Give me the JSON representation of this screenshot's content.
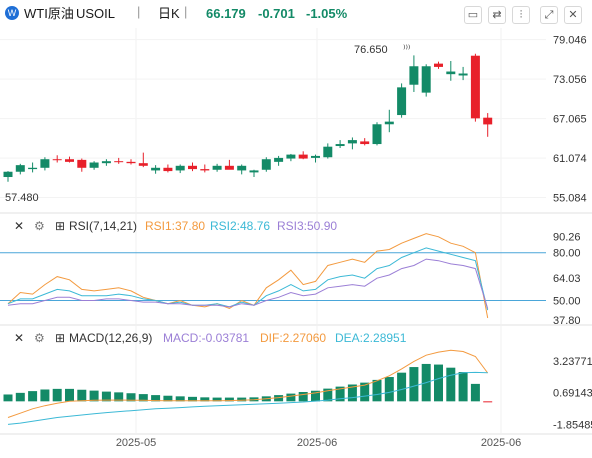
{
  "toolbar": {
    "symbol_name": "WTI原油",
    "symbol_code": "USOIL",
    "interval": "日K",
    "price": "66.179",
    "change": "-0.701",
    "change_pct": "-1.05%",
    "icons": [
      "chart-settings-icon",
      "compare-icon",
      "indicators-icon",
      "fullscreen-icon",
      "close-icon"
    ]
  },
  "main": {
    "high_label": "76.650",
    "low_label": "57.480"
  },
  "rsi": {
    "title": "RSI(7,14,21)",
    "rsi1_label": "RSI1:37.80",
    "rsi2_label": "RSI2:48.76",
    "rsi3_label": "RSI3:50.90"
  },
  "macd": {
    "title": "MACD(12,26,9)",
    "macd_label": "MACD:-0.03781",
    "dif_label": "DIF:2.27060",
    "dea_label": "DEA:2.28951"
  },
  "colors": {
    "up": "#138a67",
    "down": "#e8202a",
    "rsi1": "#f39a3f",
    "rsi2": "#3cb9d6",
    "rsi3": "#9b7fd6",
    "dif": "#f39a3f",
    "dea": "#3cb9d6",
    "ref_line": "#4aa6d9"
  },
  "chart_data": [
    {
      "type": "candlestick",
      "name": "price",
      "x_ticks": [
        "2025-05",
        "2025-06",
        "2025-06"
      ],
      "y_ticks": [
        79.046,
        73.056,
        67.065,
        61.074,
        55.084
      ],
      "ylim": [
        53.5,
        80.5
      ],
      "ohlc": [
        [
          58.2,
          59.1,
          57.48,
          59.0
        ],
        [
          59.0,
          60.2,
          58.6,
          60.0
        ],
        [
          59.4,
          60.4,
          58.9,
          59.6
        ],
        [
          59.6,
          61.2,
          59.2,
          60.9
        ],
        [
          60.9,
          61.5,
          60.4,
          60.8
        ],
        [
          60.9,
          61.3,
          60.4,
          60.5
        ],
        [
          60.8,
          61.0,
          59.0,
          59.6
        ],
        [
          59.6,
          60.6,
          59.3,
          60.4
        ],
        [
          60.3,
          60.9,
          59.9,
          60.6
        ],
        [
          60.6,
          61.1,
          60.2,
          60.5
        ],
        [
          60.5,
          60.9,
          60.1,
          60.3
        ],
        [
          60.3,
          61.9,
          59.7,
          59.9
        ],
        [
          59.2,
          60.0,
          58.7,
          59.6
        ],
        [
          59.6,
          60.1,
          58.9,
          59.1
        ],
        [
          59.2,
          60.1,
          58.8,
          59.9
        ],
        [
          59.9,
          60.4,
          59.1,
          59.4
        ],
        [
          59.4,
          60.1,
          58.9,
          59.2
        ],
        [
          59.3,
          60.2,
          59.0,
          59.9
        ],
        [
          59.9,
          60.8,
          59.5,
          59.3
        ],
        [
          59.2,
          60.1,
          58.6,
          59.9
        ],
        [
          58.9,
          59.3,
          58.2,
          59.2
        ],
        [
          59.3,
          61.2,
          59.0,
          60.9
        ],
        [
          60.5,
          61.4,
          59.9,
          61.1
        ],
        [
          61.0,
          61.7,
          60.6,
          61.6
        ],
        [
          61.6,
          62.1,
          60.9,
          61.0
        ],
        [
          61.1,
          61.6,
          60.4,
          61.4
        ],
        [
          61.2,
          63.3,
          61.0,
          62.8
        ],
        [
          62.9,
          63.8,
          62.6,
          63.2
        ],
        [
          63.3,
          64.2,
          62.4,
          63.8
        ],
        [
          63.6,
          64.1,
          63.0,
          63.2
        ],
        [
          63.2,
          66.5,
          63.0,
          66.2
        ],
        [
          66.2,
          68.4,
          65.0,
          66.6
        ],
        [
          67.6,
          72.4,
          67.2,
          71.8
        ],
        [
          72.2,
          76.65,
          71.1,
          75.0
        ],
        [
          71.0,
          75.3,
          70.4,
          75.0
        ],
        [
          75.4,
          75.7,
          74.6,
          74.9
        ],
        [
          73.8,
          75.8,
          72.8,
          74.2
        ],
        [
          73.6,
          74.9,
          72.9,
          73.9
        ],
        [
          76.6,
          76.9,
          66.6,
          67.1
        ],
        [
          67.2,
          67.9,
          64.3,
          66.179
        ]
      ]
    },
    {
      "type": "line",
      "name": "RSI",
      "y_ticks": [
        90.26,
        80.0,
        64.03,
        50.0,
        37.8
      ],
      "ylim": [
        34,
        93
      ],
      "reference_lines": [
        80,
        50
      ],
      "series": [
        {
          "name": "RSI1",
          "values": [
            48,
            55,
            54,
            60,
            65,
            63,
            57,
            56,
            57,
            58,
            56,
            52,
            50,
            48,
            50,
            47,
            46,
            48,
            45,
            50,
            47,
            58,
            63,
            69,
            60,
            62,
            72,
            74,
            76,
            74,
            81,
            82,
            86,
            89,
            92,
            90,
            86,
            84,
            80,
            39
          ]
        },
        {
          "name": "RSI2",
          "values": [
            48,
            51,
            51,
            54,
            57,
            56,
            53,
            53,
            53,
            54,
            53,
            51,
            50,
            48,
            49,
            47,
            47,
            48,
            46,
            49,
            47,
            53,
            56,
            60,
            56,
            57,
            63,
            65,
            66,
            64,
            70,
            72,
            77,
            80,
            83,
            81,
            79,
            77,
            75,
            44
          ]
        },
        {
          "name": "RSI3",
          "values": [
            47,
            48,
            48,
            50,
            52,
            52,
            50,
            50,
            51,
            51,
            50,
            49,
            49,
            48,
            48,
            47,
            47,
            47,
            46,
            48,
            47,
            50,
            52,
            55,
            53,
            54,
            58,
            59,
            60,
            59,
            64,
            66,
            70,
            72,
            76,
            75,
            73,
            72,
            70,
            45
          ]
        }
      ],
      "last_values": {
        "RSI1": 37.8,
        "RSI2": 48.76,
        "RSI3": 50.9
      }
    },
    {
      "type": "bar+line",
      "name": "MACD",
      "y_ticks": [
        3.23771,
        0.69143,
        -1.85485
      ],
      "ylim": [
        -2.3,
        4.6
      ],
      "histogram": [
        0.55,
        0.68,
        0.82,
        0.95,
        1.0,
        1.0,
        0.93,
        0.86,
        0.78,
        0.72,
        0.65,
        0.58,
        0.5,
        0.45,
        0.4,
        0.36,
        0.32,
        0.3,
        0.3,
        0.3,
        0.32,
        0.4,
        0.5,
        0.62,
        0.75,
        0.85,
        1.02,
        1.18,
        1.35,
        1.5,
        1.72,
        1.95,
        2.3,
        2.75,
        3.0,
        2.95,
        2.7,
        2.35,
        1.4,
        -0.03781
      ],
      "series": [
        {
          "name": "DIF",
          "values": [
            -1.3,
            -0.95,
            -0.6,
            -0.35,
            -0.15,
            0.0,
            0.05,
            0.08,
            0.1,
            0.1,
            0.09,
            0.08,
            0.06,
            0.05,
            0.05,
            0.04,
            0.04,
            0.05,
            0.06,
            0.08,
            0.12,
            0.2,
            0.3,
            0.42,
            0.55,
            0.68,
            0.85,
            1.0,
            1.15,
            1.3,
            1.65,
            2.05,
            2.6,
            3.2,
            3.7,
            3.95,
            4.1,
            4.0,
            3.6,
            2.2706
          ]
        },
        {
          "name": "DEA",
          "values": [
            -1.85,
            -1.75,
            -1.6,
            -1.45,
            -1.3,
            -1.2,
            -1.1,
            -1.0,
            -0.9,
            -0.82,
            -0.75,
            -0.68,
            -0.6,
            -0.55,
            -0.5,
            -0.45,
            -0.4,
            -0.36,
            -0.32,
            -0.28,
            -0.24,
            -0.2,
            -0.15,
            -0.1,
            -0.05,
            0.02,
            0.1,
            0.2,
            0.3,
            0.42,
            0.55,
            0.72,
            0.95,
            1.22,
            1.5,
            1.82,
            2.1,
            2.3,
            2.32,
            2.28951
          ]
        }
      ],
      "last_values": {
        "MACD": -0.03781,
        "DIF": 2.2706,
        "DEA": 2.28951
      }
    }
  ]
}
